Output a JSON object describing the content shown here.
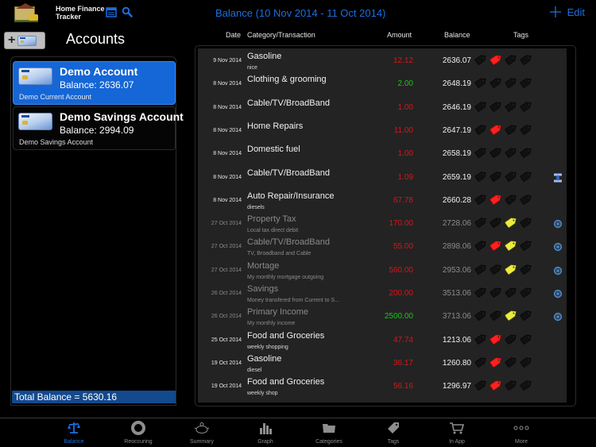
{
  "app": {
    "title_line1": "Home Finance",
    "title_line2": "Tracker",
    "icons": [
      "house-logo-icon",
      "calendar-icon",
      "search-icon"
    ]
  },
  "accounts": {
    "title": "Accounts",
    "add_button_icon": "add-account-icon",
    "items": [
      {
        "name": "Demo Account",
        "balance": "Balance: 2636.07",
        "description": "Demo Current Account",
        "selected": true,
        "icon": "credit-card-icon"
      },
      {
        "name": "Demo Savings Account",
        "balance": "Balance: 2994.09",
        "description": "Demo Savings Account",
        "selected": false,
        "icon": "credit-card-icon"
      }
    ],
    "total_balance": "Total Balance = 5630.16"
  },
  "header": {
    "title": "Balance (10 Nov 2014 - 11 Oct 2014)",
    "add_icon": "plus-icon",
    "edit_label": "Edit"
  },
  "columns": {
    "date": "Date",
    "category": "Category/Transaction",
    "amount": "Amount",
    "balance": "Balance",
    "tags": "Tags"
  },
  "colors": {
    "accent": "#1a6fe0",
    "negative": "#d8141a",
    "positive": "#1ec21e",
    "tag_red": "#ff2020",
    "tag_yellow": "#ecec40",
    "tag_off": "#111111"
  },
  "transactions": [
    {
      "date": "9 Nov 2014",
      "category": "Gasoline",
      "note": "nice",
      "amount": "12.12",
      "type": "negative",
      "balance": "2636.07",
      "tags": [
        "off",
        "red",
        "off",
        "off"
      ],
      "faded": false,
      "icon": ""
    },
    {
      "date": "8 Nov 2014",
      "category": "Clothing & grooming",
      "note": "",
      "amount": "2.00",
      "type": "positive",
      "balance": "2648.19",
      "tags": [
        "off",
        "off",
        "off",
        "off"
      ],
      "faded": false,
      "icon": ""
    },
    {
      "date": "8 Nov 2014",
      "category": "Cable/TV/BroadBand",
      "note": "",
      "amount": "1.00",
      "type": "negative",
      "balance": "2646.19",
      "tags": [
        "off",
        "off",
        "off",
        "off"
      ],
      "faded": false,
      "icon": ""
    },
    {
      "date": "8 Nov 2014",
      "category": "Home Repairs",
      "note": "",
      "amount": "11.00",
      "type": "negative",
      "balance": "2647.19",
      "tags": [
        "off",
        "red",
        "off",
        "off"
      ],
      "faded": false,
      "icon": ""
    },
    {
      "date": "8 Nov 2014",
      "category": "Domestic fuel",
      "note": "",
      "amount": "1.00",
      "type": "negative",
      "balance": "2658.19",
      "tags": [
        "off",
        "off",
        "off",
        "off"
      ],
      "faded": false,
      "icon": ""
    },
    {
      "date": "8 Nov 2014",
      "category": "Cable/TV/BroadBand",
      "note": "",
      "amount": "1.09",
      "type": "negative",
      "balance": "2659.19",
      "tags": [
        "off",
        "off",
        "off",
        "off"
      ],
      "faded": false,
      "icon": "transfer-icon"
    },
    {
      "date": "8 Nov 2014",
      "category": "Auto Repair/Insurance",
      "note": "diesels",
      "amount": "67.78",
      "type": "negative",
      "balance": "2660.28",
      "tags": [
        "off",
        "red",
        "off",
        "off"
      ],
      "faded": false,
      "icon": ""
    },
    {
      "date": "27 Oct 2014",
      "category": "Property Tax",
      "note": "Local tax direct debit",
      "amount": "170.00",
      "type": "negative",
      "balance": "2728.06",
      "tags": [
        "off",
        "off",
        "yellow",
        "off"
      ],
      "faded": true,
      "icon": "recurring-icon"
    },
    {
      "date": "27 Oct 2014",
      "category": "Cable/TV/BroadBand",
      "note": "TV, Broadband and Cable",
      "amount": "55.00",
      "type": "negative",
      "balance": "2898.06",
      "tags": [
        "off",
        "red",
        "yellow",
        "off"
      ],
      "faded": true,
      "icon": "recurring-icon"
    },
    {
      "date": "27 Oct 2014",
      "category": "Mortage",
      "note": "My monthly mortgage outgoing",
      "amount": "560.00",
      "type": "negative",
      "balance": "2953.06",
      "tags": [
        "off",
        "off",
        "yellow",
        "off"
      ],
      "faded": true,
      "icon": "recurring-icon"
    },
    {
      "date": "26 Oct 2014",
      "category": "Savings",
      "note": "Money transfered from Current to S...",
      "amount": "200.00",
      "type": "negative",
      "balance": "3513.06",
      "tags": [
        "off",
        "off",
        "off",
        "off"
      ],
      "faded": true,
      "icon": "recurring-icon"
    },
    {
      "date": "26 Oct 2014",
      "category": "Primary Income",
      "note": "My monthly income",
      "amount": "2500.00",
      "type": "positive",
      "balance": "3713.06",
      "tags": [
        "off",
        "off",
        "yellow",
        "off"
      ],
      "faded": true,
      "icon": "recurring-icon"
    },
    {
      "date": "25 Oct 2014",
      "category": "Food and Groceries",
      "note": "weekly shopping",
      "amount": "47.74",
      "type": "negative",
      "balance": "1213.06",
      "tags": [
        "off",
        "red",
        "off",
        "off"
      ],
      "faded": false,
      "icon": ""
    },
    {
      "date": "19 Oct 2014",
      "category": "Gasoline",
      "note": "diesel",
      "amount": "36.17",
      "type": "negative",
      "balance": "1260.80",
      "tags": [
        "off",
        "red",
        "off",
        "off"
      ],
      "faded": false,
      "icon": ""
    },
    {
      "date": "19 Oct 2014",
      "category": "Food and Groceries",
      "note": "weekly shop",
      "amount": "56.16",
      "type": "negative",
      "balance": "1296.97",
      "tags": [
        "off",
        "red",
        "off",
        "off"
      ],
      "faded": false,
      "icon": ""
    }
  ],
  "tabbar": [
    {
      "label": "Balance",
      "icon": "scales-icon",
      "active": true
    },
    {
      "label": "Reoccuring",
      "icon": "recurring-icon",
      "active": false
    },
    {
      "label": "Summary",
      "icon": "piggy-bank-icon",
      "active": false
    },
    {
      "label": "Graph",
      "icon": "bar-graph-icon",
      "active": false
    },
    {
      "label": "Categories",
      "icon": "folder-icon",
      "active": false
    },
    {
      "label": "Tags",
      "icon": "tag-icon",
      "active": false
    },
    {
      "label": "In App",
      "icon": "cart-icon",
      "active": false
    },
    {
      "label": "More",
      "icon": "more-dots-icon",
      "active": false
    }
  ]
}
